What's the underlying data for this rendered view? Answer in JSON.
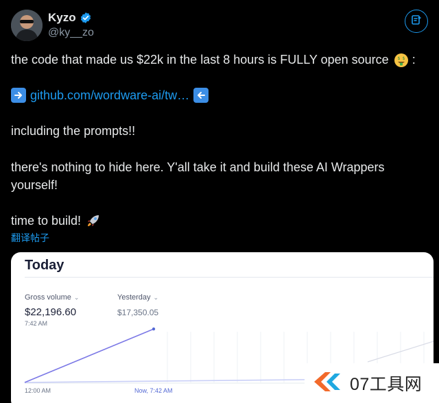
{
  "user": {
    "name": "Kyzo",
    "handle": "@ky__zo"
  },
  "tweet": {
    "line1": "the code that made us $22k in the last 8 hours is FULLY open source",
    "line1_end": ":",
    "link": "github.com/wordware-ai/tw…",
    "line3": "including the prompts!!",
    "line4": "there's nothing to hide here. Y'all take it and build these AI Wrappers yourself!",
    "line5": "time to build!",
    "translate": "翻译帖子"
  },
  "dashboard": {
    "title": "Today",
    "gross_volume_label": "Gross volume",
    "gross_volume_value": "$22,196.60",
    "gross_volume_time": "7:42 AM",
    "yesterday_label": "Yesterday",
    "yesterday_value": "$17,350.05",
    "axis_start": "12:00 AM",
    "axis_now": "Now, 7:42 AM"
  },
  "watermark": {
    "text": "07工具网"
  },
  "colors": {
    "background": "#000000",
    "text": "#e7e9ea",
    "muted": "#8b98a5",
    "link": "#1d9bf0",
    "chart_line": "#7b78e6"
  },
  "icons": {
    "verified": "verified-badge-icon",
    "translate": "translate-icon",
    "arrow_right": "arrow-right-icon",
    "arrow_left": "arrow-left-icon",
    "money_face": "money-mouth-face-icon",
    "rocket": "rocket-icon"
  }
}
